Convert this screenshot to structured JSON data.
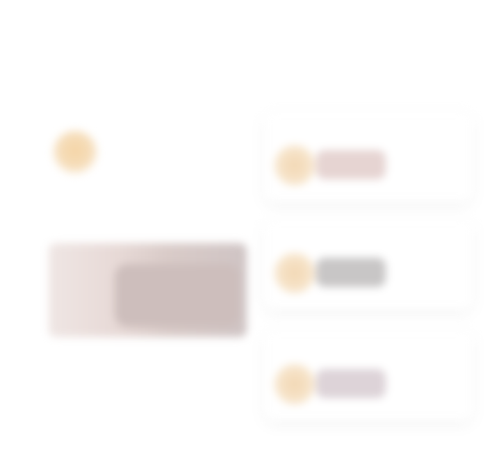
{
  "header": {
    "title": "",
    "link": ""
  },
  "left": {
    "section_label": "",
    "user": {
      "name": "",
      "meta": ""
    },
    "caption": "",
    "sub": ""
  },
  "cards": [
    {
      "title": "",
      "sub": ""
    },
    {
      "title": "",
      "sub": ""
    },
    {
      "title": "",
      "sub": ""
    }
  ],
  "colors": {
    "accent_peach": "#f4d4a5",
    "photo_mauve": "#d9cbc8",
    "pill_gray": "#c8c6c6"
  }
}
